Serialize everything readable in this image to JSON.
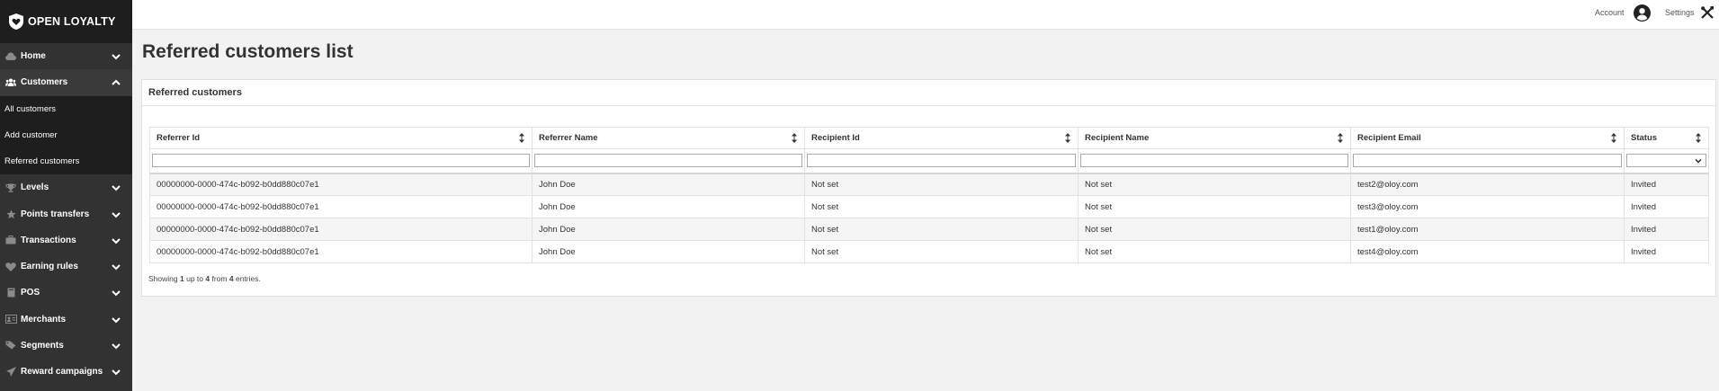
{
  "app": {
    "logo_text": "OPEN LOYALTY"
  },
  "sidebar": {
    "items": [
      {
        "label": "Home",
        "icon": "cloud-icon",
        "open": false
      },
      {
        "label": "Customers",
        "icon": "users-icon",
        "open": true,
        "children": [
          "All customers",
          "Add customer",
          "Referred customers"
        ]
      },
      {
        "label": "Levels",
        "icon": "trophy-icon",
        "open": false
      },
      {
        "label": "Points transfers",
        "icon": "star-icon",
        "open": false
      },
      {
        "label": "Transactions",
        "icon": "briefcase-icon",
        "open": false
      },
      {
        "label": "Earning rules",
        "icon": "heart-icon",
        "open": false
      },
      {
        "label": "POS",
        "icon": "book-icon",
        "open": false
      },
      {
        "label": "Merchants",
        "icon": "id-card-icon",
        "open": false
      },
      {
        "label": "Segments",
        "icon": "tag-icon",
        "open": false
      },
      {
        "label": "Reward campaigns",
        "icon": "paper-plane-icon",
        "open": false
      }
    ]
  },
  "topbar": {
    "account_label": "Account",
    "settings_label": "Settings"
  },
  "page": {
    "title": "Referred customers list"
  },
  "panel": {
    "title": "Referred customers"
  },
  "table": {
    "columns": [
      "Referrer Id",
      "Referrer Name",
      "Recipient Id",
      "Recipient Name",
      "Recipient Email",
      "Status"
    ],
    "rows": [
      [
        "00000000-0000-474c-b092-b0dd880c07e1",
        "John Doe",
        "Not set",
        "Not set",
        "test2@oloy.com",
        "Invited"
      ],
      [
        "00000000-0000-474c-b092-b0dd880c07e1",
        "John Doe",
        "Not set",
        "Not set",
        "test3@oloy.com",
        "Invited"
      ],
      [
        "00000000-0000-474c-b092-b0dd880c07e1",
        "John Doe",
        "Not set",
        "Not set",
        "test1@oloy.com",
        "Invited"
      ],
      [
        "00000000-0000-474c-b092-b0dd880c07e1",
        "John Doe",
        "Not set",
        "Not set",
        "test4@oloy.com",
        "Invited"
      ]
    ],
    "status_filter_value": ""
  },
  "footer": {
    "prefix": "Showing",
    "from": "1",
    "mid1": "up to",
    "to": "4",
    "mid2": "from",
    "total": "4",
    "suffix": "entries."
  },
  "colors": {
    "sidebar_bg": "#323232",
    "sidebar_logo_bg": "#1e1e1e",
    "submenu_bg": "#1e1e1e",
    "page_bg": "#f2f2f2"
  }
}
